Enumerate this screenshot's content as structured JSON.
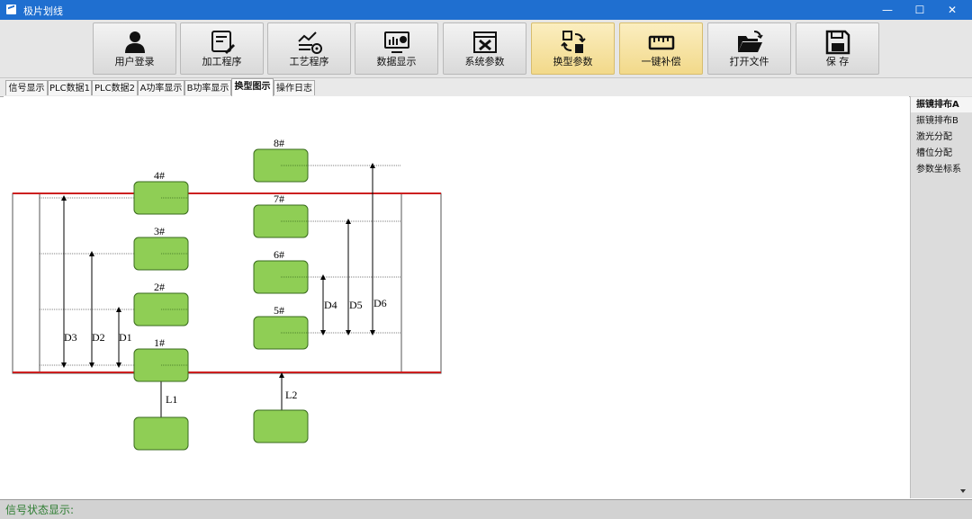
{
  "window": {
    "title": "极片划线",
    "minimize": "—",
    "maximize": "☐",
    "close": "✕"
  },
  "toolbar": {
    "buttons": [
      {
        "label": "用户登录",
        "icon": "user-icon"
      },
      {
        "label": "加工程序",
        "icon": "program-edit-icon"
      },
      {
        "label": "工艺程序",
        "icon": "process-chart-icon"
      },
      {
        "label": "数据显示",
        "icon": "monitor-chart-icon"
      },
      {
        "label": "系统参数",
        "icon": "system-tools-icon"
      },
      {
        "label": "换型参数",
        "icon": "changeover-icon",
        "active": true
      },
      {
        "label": "一键补偿",
        "icon": "ruler-icon",
        "active": true
      },
      {
        "label": "打开文件",
        "icon": "folder-open-icon"
      },
      {
        "label": "保   存",
        "icon": "save-disk-icon"
      }
    ]
  },
  "tabs": [
    {
      "label": "信号显示"
    },
    {
      "label": "PLC数据1"
    },
    {
      "label": "PLC数据2"
    },
    {
      "label": "A功率显示"
    },
    {
      "label": "B功率显示"
    },
    {
      "label": "换型图示",
      "active": true
    },
    {
      "label": "操作日志"
    }
  ],
  "side_menu": [
    {
      "label": "振镜排布A",
      "active": true
    },
    {
      "label": "振镜排布B"
    },
    {
      "label": "激光分配"
    },
    {
      "label": "槽位分配"
    },
    {
      "label": "参数坐标系"
    }
  ],
  "diagram": {
    "heads": {
      "h1": "1#",
      "h2": "2#",
      "h3": "3#",
      "h4": "4#",
      "h5": "5#",
      "h6": "6#",
      "h7": "7#",
      "h8": "8#"
    },
    "dims": {
      "d1": "D1",
      "d2": "D2",
      "d3": "D3",
      "d4": "D4",
      "d5": "D5",
      "d6": "D6",
      "l1": "L1",
      "l2": "L2"
    },
    "colors": {
      "head_fill": "#8fce55",
      "head_stroke": "#3a6b1e",
      "strip_border": "#cc1f1f"
    }
  },
  "status": {
    "label": "信号状态显示:"
  }
}
